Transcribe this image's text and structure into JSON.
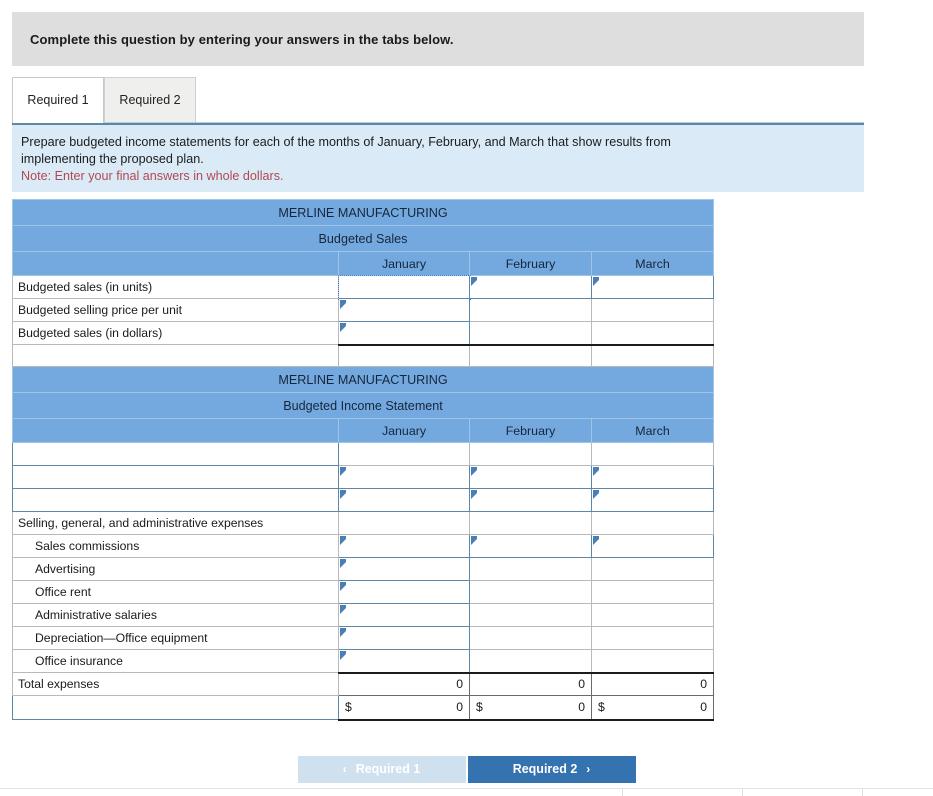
{
  "banner": {
    "text": "Complete this question by entering your answers in the tabs below."
  },
  "tabs": [
    {
      "label": "Required 1",
      "active": true
    },
    {
      "label": "Required 2",
      "active": false
    }
  ],
  "instructions": {
    "line1": "Prepare budgeted income statements for each of the months of January, February, and March that show results from",
    "line2": "implementing the proposed plan.",
    "note": "Note: Enter your final answers in whole dollars."
  },
  "sales_table": {
    "company": "MERLINE MANUFACTURING",
    "subtitle": "Budgeted Sales",
    "blank_header": "",
    "months": [
      "January",
      "February",
      "March"
    ],
    "rows": [
      {
        "label": "Budgeted sales (in units)",
        "january": "",
        "february": "",
        "march": ""
      },
      {
        "label": "Budgeted selling price per unit",
        "january": "",
        "february": "",
        "march": ""
      },
      {
        "label": "Budgeted sales (in dollars)",
        "january": "",
        "february": "",
        "march": ""
      }
    ]
  },
  "income_table": {
    "company": "MERLINE MANUFACTURING",
    "subtitle": "Budgeted Income Statement",
    "blank_header": "",
    "months": [
      "January",
      "February",
      "March"
    ],
    "rows": [
      {
        "label": "",
        "january": "",
        "february": "",
        "march": ""
      },
      {
        "label": "",
        "january": "",
        "february": "",
        "march": ""
      },
      {
        "label": "",
        "january": "",
        "february": "",
        "march": ""
      },
      {
        "label": "Selling, general, and administrative expenses",
        "january": "",
        "february": "",
        "march": ""
      },
      {
        "label": "Sales commissions",
        "january": "",
        "february": "",
        "march": ""
      },
      {
        "label": "Advertising",
        "january": "",
        "february": "",
        "march": ""
      },
      {
        "label": "Office rent",
        "january": "",
        "february": "",
        "march": ""
      },
      {
        "label": "Administrative salaries",
        "january": "",
        "february": "",
        "march": ""
      },
      {
        "label": "Depreciation—Office equipment",
        "january": "",
        "february": "",
        "march": ""
      },
      {
        "label": "Office insurance",
        "january": "",
        "february": "",
        "march": ""
      }
    ],
    "total_row": {
      "label": "Total expenses",
      "january": "0",
      "february": "0",
      "march": "0"
    },
    "net_row": {
      "label": "",
      "currency": "$",
      "january": "0",
      "february": "0",
      "march": "0"
    }
  },
  "footer": {
    "prev_label": "Required 1",
    "next_label": "Required 2",
    "prev_chevron": "‹",
    "next_chevron": "›"
  },
  "colors": {
    "header_blue": "#74a9e0",
    "instruction_blue": "#dbeaf7",
    "banner_gray": "#dedede",
    "note_red": "#b14a50",
    "next_button_blue": "#3572b0",
    "prev_button_blue": "#cfe0ef",
    "input_border": "#5d87a6"
  }
}
